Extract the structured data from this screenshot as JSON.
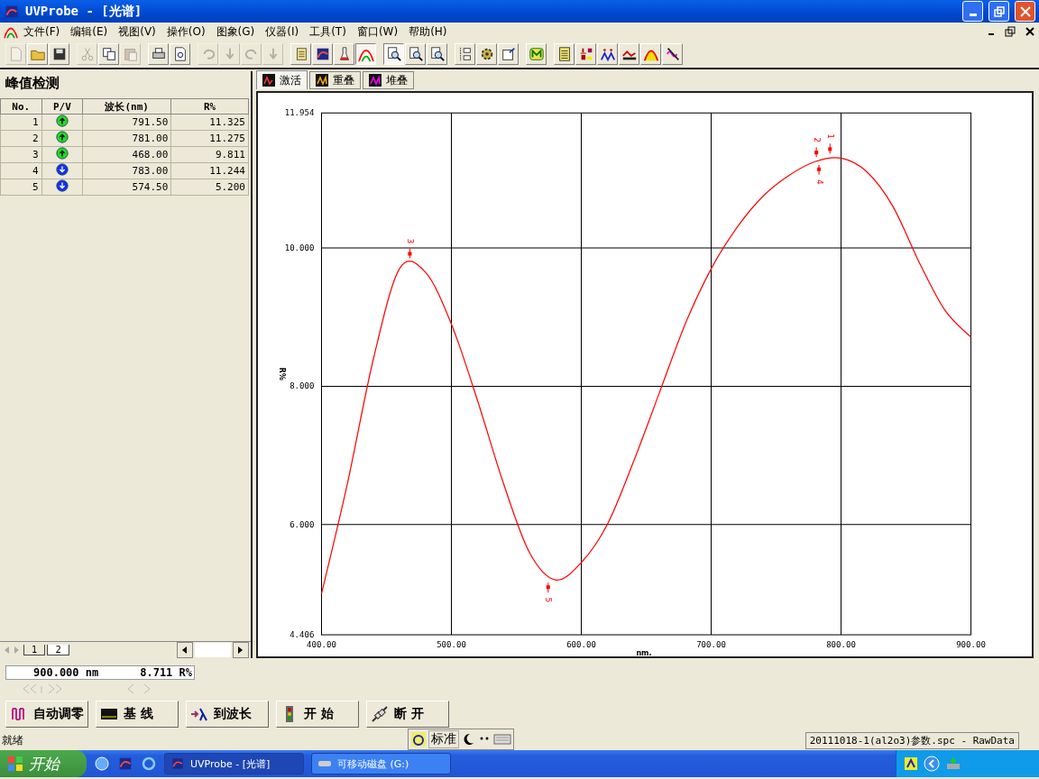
{
  "window": {
    "title": "UVProbe - [光谱]"
  },
  "menu": [
    "文件(F)",
    "编辑(E)",
    "视图(V)",
    "操作(O)",
    "图象(G)",
    "仪器(I)",
    "工具(T)",
    "窗口(W)",
    "帮助(H)"
  ],
  "toolbar": [
    [
      {
        "kind": "document",
        "disabled": true,
        "pressed": false
      },
      {
        "kind": "folder",
        "disabled": false,
        "pressed": false
      },
      {
        "kind": "disk",
        "disabled": false,
        "pressed": false
      }
    ],
    [
      {
        "kind": "scissors",
        "disabled": true,
        "pressed": false
      },
      {
        "kind": "copy",
        "disabled": false,
        "pressed": false
      },
      {
        "kind": "paste",
        "disabled": true,
        "pressed": false
      }
    ],
    [
      {
        "kind": "printer",
        "disabled": false,
        "pressed": false
      },
      {
        "kind": "preview",
        "disabled": false,
        "pressed": false
      }
    ],
    [
      {
        "kind": "undo",
        "disabled": true,
        "pressed": false
      },
      {
        "kind": "down",
        "disabled": true,
        "pressed": false
      },
      {
        "kind": "redo",
        "disabled": true,
        "pressed": false
      },
      {
        "kind": "down",
        "disabled": true,
        "pressed": false
      }
    ],
    [
      {
        "kind": "scroll",
        "disabled": false,
        "pressed": false
      },
      {
        "kind": "spectrum",
        "disabled": false,
        "pressed": false
      },
      {
        "kind": "flask",
        "disabled": false,
        "pressed": false
      },
      {
        "kind": "rainbow",
        "disabled": false,
        "pressed": true
      }
    ],
    [
      {
        "kind": "zoom",
        "disabled": false,
        "pressed": true
      },
      {
        "kind": "zoom",
        "disabled": false,
        "pressed": false
      },
      {
        "kind": "zoom",
        "disabled": false,
        "pressed": false
      }
    ],
    [
      {
        "kind": "list",
        "disabled": false,
        "pressed": false
      },
      {
        "kind": "gear",
        "disabled": false,
        "pressed": false
      },
      {
        "kind": "settings",
        "disabled": false,
        "pressed": false
      }
    ],
    [
      {
        "kind": "badge",
        "disabled": false,
        "pressed": false
      }
    ],
    [
      {
        "kind": "notes",
        "disabled": false,
        "pressed": false
      },
      {
        "kind": "derivative",
        "disabled": false,
        "pressed": false
      },
      {
        "kind": "peaks",
        "disabled": false,
        "pressed": false
      },
      {
        "kind": "area",
        "disabled": false,
        "pressed": false
      },
      {
        "kind": "peak",
        "disabled": false,
        "pressed": false
      },
      {
        "kind": "pen",
        "disabled": false,
        "pressed": false
      }
    ]
  ],
  "peak_panel": {
    "title": "峰值检测",
    "columns": [
      "No.",
      "P/V",
      "波长(nm)",
      "R%"
    ],
    "rows": [
      {
        "no": "1",
        "peak": true,
        "wavelength": "791.50",
        "r": "11.325"
      },
      {
        "no": "2",
        "peak": true,
        "wavelength": "781.00",
        "r": "11.275"
      },
      {
        "no": "3",
        "peak": true,
        "wavelength": "468.00",
        "r": "9.811"
      },
      {
        "no": "4",
        "peak": false,
        "wavelength": "783.00",
        "r": "11.244"
      },
      {
        "no": "5",
        "peak": false,
        "wavelength": "574.50",
        "r": "5.200"
      }
    ],
    "sheet_tabs": [
      {
        "label": "1",
        "selected": false
      },
      {
        "label": "2",
        "selected": true
      }
    ]
  },
  "chart_tabs": [
    {
      "label": "激活",
      "selected": true
    },
    {
      "label": "重叠",
      "selected": false
    },
    {
      "label": "堆叠",
      "selected": false
    }
  ],
  "chart_data": {
    "type": "line",
    "xlabel": "nm.",
    "ylabel": "R%",
    "xlim": [
      400,
      900
    ],
    "ylim": [
      4.406,
      11.954
    ],
    "xticks": [
      {
        "value": 400,
        "label": "400.00"
      },
      {
        "value": 500,
        "label": "500.00"
      },
      {
        "value": 600,
        "label": "600.00"
      },
      {
        "value": 700,
        "label": "700.00"
      },
      {
        "value": 800,
        "label": "800.00"
      },
      {
        "value": 900,
        "label": "900.00"
      }
    ],
    "yticks": [
      {
        "value": 4.406,
        "label": "4.406"
      },
      {
        "value": 6,
        "label": "6.000"
      },
      {
        "value": 8,
        "label": "8.000"
      },
      {
        "value": 10,
        "label": "10.000"
      },
      {
        "value": 11.954,
        "label": "11.954"
      }
    ],
    "x": [
      400,
      420,
      440,
      460,
      480,
      500,
      520,
      540,
      560,
      580,
      600,
      620,
      640,
      660,
      680,
      700,
      720,
      740,
      760,
      780,
      800,
      820,
      840,
      860,
      880,
      900
    ],
    "grid": true,
    "series": [
      {
        "color": "#ff0000",
        "values": [
          5.0,
          6.6,
          8.4,
          9.7,
          9.65,
          8.9,
          7.8,
          6.6,
          5.6,
          5.2,
          5.45,
          6.0,
          6.9,
          7.9,
          8.9,
          9.7,
          10.3,
          10.75,
          11.05,
          11.25,
          11.3,
          11.1,
          10.6,
          9.8,
          9.1,
          8.71
        ]
      }
    ],
    "annotations": [
      "1",
      "2",
      "3",
      "4",
      "5"
    ]
  },
  "reading": {
    "wavelength": "900.000 nm",
    "value": "8.711 R%"
  },
  "actions": [
    {
      "label": "自动调零",
      "kind": "autozero"
    },
    {
      "label": "基 线",
      "kind": "baseline"
    },
    {
      "label": "到波长",
      "kind": "goto"
    },
    {
      "label": "开 始",
      "kind": "start"
    },
    {
      "label": "断 开",
      "kind": "disconnect"
    }
  ],
  "status_bar": {
    "text": "就绪",
    "file": "20111018-1(al2o3)参数.spc - RawData"
  },
  "ime": {
    "mode": "标准"
  },
  "taskbar": {
    "start": "开始",
    "tasks": [
      {
        "label": "UVProbe - [光谱]",
        "selected": true
      },
      {
        "label": "可移动磁盘 (G:)",
        "selected": false
      }
    ]
  }
}
